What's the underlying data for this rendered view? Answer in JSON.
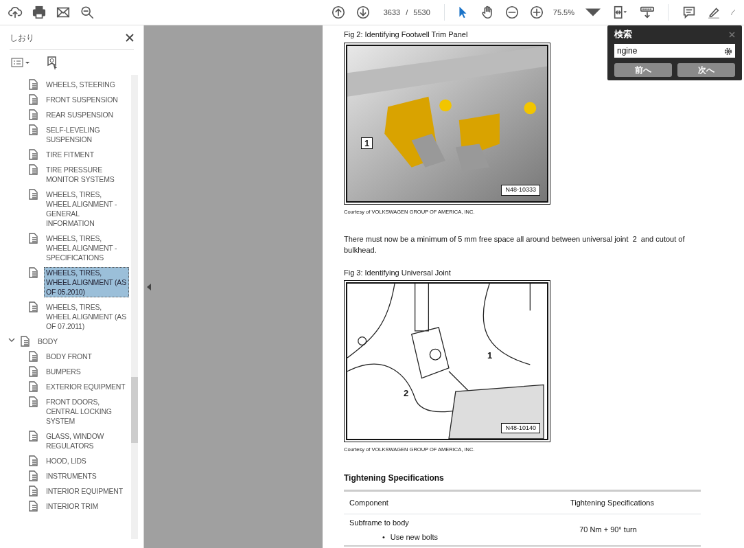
{
  "toolbar": {
    "page": {
      "current": "3633",
      "separator": "/",
      "total": "5530"
    },
    "tools": [
      {
        "kind": "select",
        "selected": true
      },
      {
        "kind": "hand",
        "selected": false
      },
      {
        "kind": "zoom-out",
        "selected": false
      },
      {
        "kind": "zoom-in",
        "selected": false
      }
    ],
    "zoom": "75.5%"
  },
  "sidebar": {
    "title": "しおり",
    "bookmarks": [
      {
        "children": [
          {
            "label": "WHEELS, STEERING",
            "selected": false
          },
          {
            "label": "FRONT SUSPENSION",
            "selected": false
          },
          {
            "label": "REAR SUSPENSION",
            "selected": false
          },
          {
            "label": "SELF-LEVELING SUSPENSION",
            "selected": false
          },
          {
            "label": "TIRE FITMENT",
            "selected": false
          },
          {
            "label": "TIRE PRESSURE MONITOR SYSTEMS",
            "selected": false
          },
          {
            "label": "WHEELS, TIRES, WHEEL ALIGNMENT - GENERAL INFORMATION",
            "selected": false
          },
          {
            "label": "WHEELS, TIRES, WHEEL ALIGNMENT - SPECIFICATIONS",
            "selected": false
          },
          {
            "label": "WHEELS, TIRES, WHEEL ALIGNMENT (AS OF 05.2010)",
            "selected": true
          },
          {
            "label": "WHEELS, TIRES, WHEEL ALIGNMENT (AS OF 07.2011)",
            "selected": false
          }
        ]
      },
      {
        "label": "BODY",
        "selected": false,
        "expanded": true,
        "children": [
          {
            "label": "BODY FRONT",
            "selected": false
          },
          {
            "label": "BUMPERS",
            "selected": false
          },
          {
            "label": "EXTERIOR EQUIPMENT",
            "selected": false
          },
          {
            "label": "FRONT DOORS, CENTRAL LOCKING SYSTEM",
            "selected": false
          },
          {
            "label": "GLASS, WINDOW REGULATORS",
            "selected": false
          },
          {
            "label": "HOOD, LIDS",
            "selected": false
          },
          {
            "label": "INSTRUMENTS",
            "selected": false
          },
          {
            "label": "INTERIOR EQUIPMENT",
            "selected": false
          },
          {
            "label": "INTERIOR TRIM",
            "selected": false
          }
        ]
      }
    ]
  },
  "document": [
    {
      "kind": "caption",
      "text": "Fig 2: Identifying Footwell Trim Panel"
    },
    {
      "kind": "figure",
      "callouts": [
        "1"
      ],
      "ref": "N48-10333"
    },
    {
      "kind": "credit",
      "text": "Courtesy of VOLKSWAGEN GROUP OF AMERICA, INC."
    },
    {
      "kind": "paragraph",
      "text": "There must now be a minimum of 5 mm free space all around between universal joint  2  and cutout of bulkhead."
    },
    {
      "kind": "caption",
      "text": "Fig 3: Identifying Universal Joint"
    },
    {
      "kind": "figure",
      "callouts": [
        "1",
        "2"
      ],
      "ref": "N48-10140"
    },
    {
      "kind": "credit",
      "text": "Courtesy of VOLKSWAGEN GROUP OF AMERICA, INC."
    },
    {
      "kind": "heading",
      "text": "Tightening Specifications"
    },
    {
      "kind": "table",
      "columns": [
        "Component",
        "Tightening Specifications"
      ],
      "rows": [
        {
          "component": "Subframe to body",
          "bullets": [
            {
              "marker": "•",
              "text": "Use new bolts"
            }
          ],
          "value": "70 Nm + 90° turn"
        }
      ]
    }
  ],
  "find": {
    "title": "検索",
    "value": "ngine",
    "buttons": [
      "前へ",
      "次へ"
    ]
  }
}
